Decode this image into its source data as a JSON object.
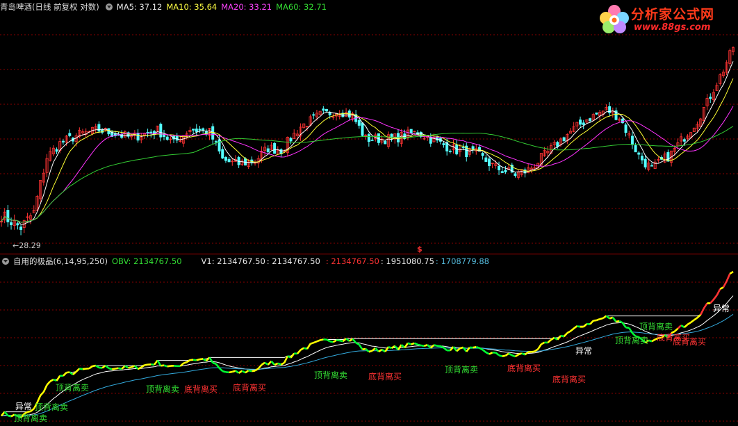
{
  "top_header": {
    "title": "青岛啤酒(日线 前复权 对数)",
    "ma5": "MA5: 37.12",
    "ma10": "MA10: 35.64",
    "ma20": "MA20: 33.21",
    "ma60": "MA60: 32.71"
  },
  "bottom_header": {
    "title": "自用的极品(6,14,95,250)",
    "obv": "OBV: 2134767.50",
    "v1": "V1: 2134767.50",
    "v2": ": 2134767.50",
    "v3": ": 2134767.50",
    "v4": ": 1951080.75",
    "v5": ": 1708779.88"
  },
  "logo": {
    "title": "分析家公式网",
    "url": "www.88gs.com"
  },
  "low_label": "28.29",
  "dollar_marker": "$",
  "colors": {
    "up": "#ff3333",
    "down": "#54ffff",
    "ma5": "#ffffff",
    "ma10": "#ffff33",
    "ma20": "#ff33ff",
    "ma60": "#33cc33",
    "obv_up": "#ffff00",
    "obv_down": "#00ff33",
    "v4": "#ffffff",
    "v5": "#33aadd"
  },
  "annotations": {
    "yichang": "异常",
    "dingbei": "顶背离卖",
    "dibei": "底背离买"
  },
  "chart_data": {
    "type": "candlestick",
    "low_marked": 28.29,
    "close_anchors": [
      [
        0,
        29.6
      ],
      [
        6,
        28.7
      ],
      [
        10,
        29.8
      ],
      [
        14,
        34.2
      ],
      [
        18,
        35.4
      ],
      [
        24,
        36.2
      ],
      [
        30,
        36.6
      ],
      [
        40,
        35.9
      ],
      [
        48,
        36.6
      ],
      [
        53,
        35.4
      ],
      [
        58,
        36.7
      ],
      [
        64,
        36.4
      ],
      [
        68,
        34.0
      ],
      [
        72,
        33.6
      ],
      [
        78,
        33.9
      ],
      [
        82,
        35.0
      ],
      [
        86,
        34.8
      ],
      [
        92,
        36.9
      ],
      [
        98,
        38.0
      ],
      [
        104,
        38.4
      ],
      [
        108,
        37.9
      ],
      [
        112,
        35.8
      ],
      [
        120,
        35.8
      ],
      [
        128,
        36.4
      ],
      [
        134,
        35.5
      ],
      [
        140,
        34.8
      ],
      [
        146,
        34.5
      ],
      [
        152,
        33.3
      ],
      [
        158,
        32.8
      ],
      [
        162,
        33.1
      ],
      [
        168,
        34.6
      ],
      [
        174,
        36.2
      ],
      [
        180,
        37.6
      ],
      [
        186,
        38.5
      ],
      [
        190,
        37.8
      ],
      [
        196,
        34.3
      ],
      [
        200,
        33.2
      ],
      [
        206,
        34.5
      ],
      [
        210,
        36.0
      ],
      [
        214,
        37.5
      ],
      [
        217,
        39.2
      ],
      [
        222,
        42.5
      ],
      [
        225,
        45.0
      ]
    ]
  }
}
